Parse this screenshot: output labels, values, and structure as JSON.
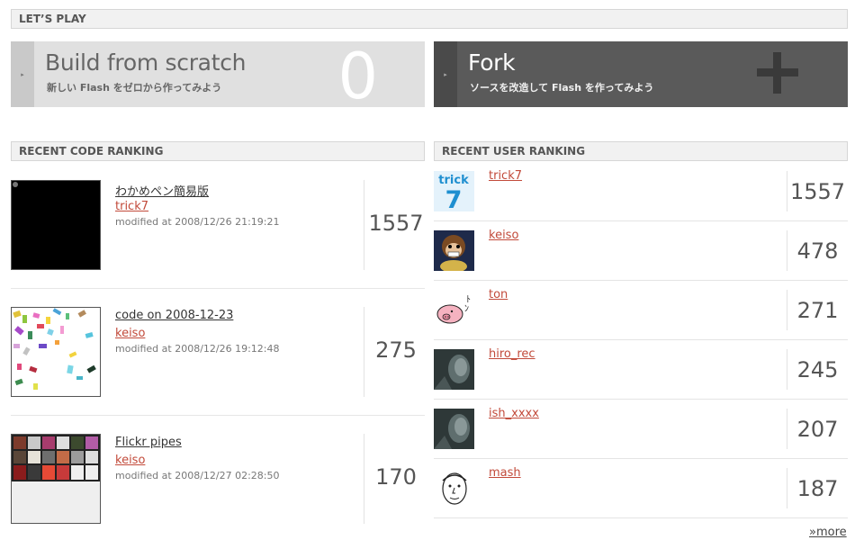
{
  "lets_play": {
    "heading": "LET’S PLAY"
  },
  "scratch": {
    "title": "Build from scratch",
    "subtitle": "新しい Flash をゼロから作ってみよう",
    "count": "0"
  },
  "fork": {
    "title": "Fork",
    "subtitle": "ソースを改造して Flash を作ってみよう",
    "icon": "plus-icon"
  },
  "code_ranking": {
    "heading": "RECENT CODE RANKING",
    "items": [
      {
        "title": "わかめペン簡易版",
        "user": "trick7",
        "modified": "modified at 2008/12/26 21:19:21",
        "score": "1557"
      },
      {
        "title": "code on 2008-12-23",
        "user": "keiso",
        "modified": "modified at 2008/12/26 19:12:48",
        "score": "275"
      },
      {
        "title": "Flickr pipes",
        "user": "keiso",
        "modified": "modified at 2008/12/27 02:28:50",
        "score": "170"
      }
    ]
  },
  "user_ranking": {
    "heading": "RECENT USER RANKING",
    "items": [
      {
        "name": "trick7",
        "score": "1557",
        "avatar_text": "trick",
        "avatar_num": "7"
      },
      {
        "name": "keiso",
        "score": "478"
      },
      {
        "name": "ton",
        "score": "271"
      },
      {
        "name": "hiro_rec",
        "score": "245"
      },
      {
        "name": "ish_xxxx",
        "score": "207"
      },
      {
        "name": "mash",
        "score": "187"
      }
    ]
  },
  "more_label": "»more",
  "colors": {
    "link": "#c24a3a",
    "accent_dark": "#5a5a5a",
    "accent_light": "#e0e0e0"
  }
}
